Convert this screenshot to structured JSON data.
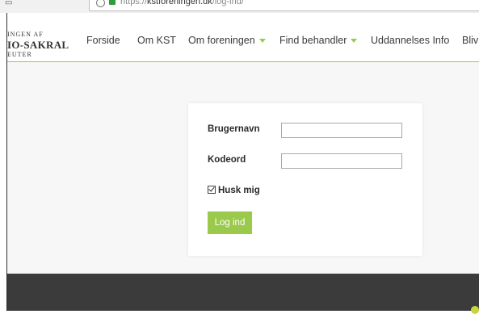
{
  "browser": {
    "url_scheme": "https://",
    "url_host": "kstforeningen.dk",
    "url_path": "/log-ind/"
  },
  "logo": {
    "line1": "INGEN AF",
    "line2": "IO-SAKRAL",
    "line3": "EUTER"
  },
  "nav": {
    "items": [
      {
        "label": "Forside"
      },
      {
        "label": "Om KST"
      },
      {
        "label": "Om foreningen"
      },
      {
        "label": "Find behandler"
      },
      {
        "label": "Uddannelses Info"
      },
      {
        "label": "Bliv"
      }
    ]
  },
  "login": {
    "username_label": "Brugernavn",
    "username_value": "",
    "password_label": "Kodeord",
    "password_value": "",
    "remember_label": "Husk mig",
    "remember_checked": true,
    "submit_label": "Log ind"
  },
  "colors": {
    "accent": "#9bc94b",
    "footer": "#3b3b3b"
  }
}
